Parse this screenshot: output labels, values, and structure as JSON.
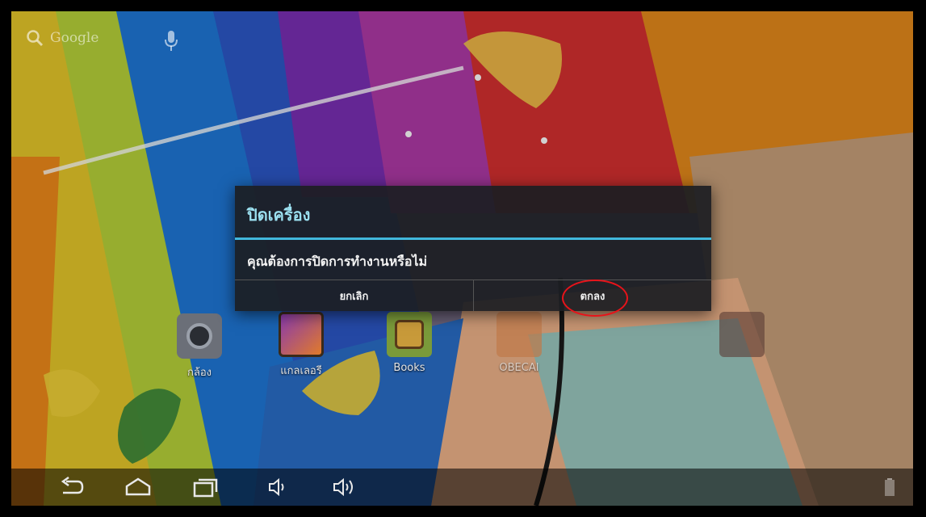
{
  "search": {
    "label": "Google"
  },
  "apps": [
    {
      "label": "กล้อง"
    },
    {
      "label": "แกลเลอรี"
    },
    {
      "label": "Books"
    },
    {
      "label": "OBECAI"
    },
    {
      "label": ""
    }
  ],
  "dialog": {
    "title": "ปิดเครื่อง",
    "message": "คุณต้องการปิดการทำงานหรือไม่",
    "cancel_label": "ยกเลิก",
    "ok_label": "ตกลง"
  },
  "navbar": {
    "icons": [
      "back-icon",
      "home-icon",
      "recent-apps-icon",
      "volume-down-icon",
      "volume-up-icon"
    ]
  },
  "colors": {
    "dialog_accent": "#41b8dc",
    "dialog_title": "#9be0f0",
    "highlight_ring": "#e8131a"
  }
}
